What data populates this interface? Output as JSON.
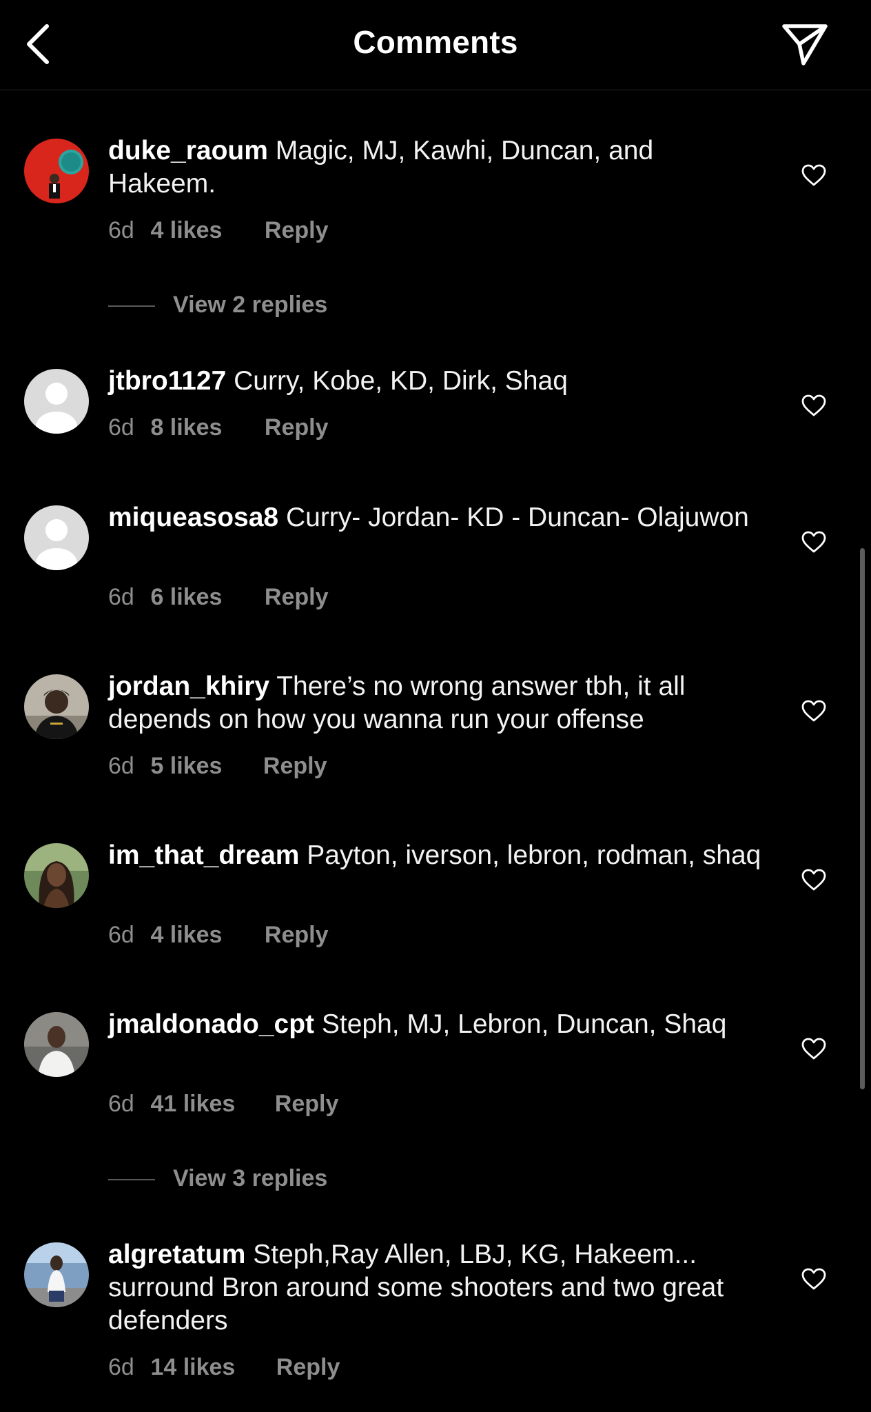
{
  "header": {
    "title": "Comments",
    "back_icon": "chevron-left-icon",
    "share_icon": "paper-plane-icon"
  },
  "colors": {
    "background": "#000000",
    "text": "#ffffff",
    "secondary_text": "#8e8e8e"
  },
  "comments": [
    {
      "username": "duke_raoum",
      "text": "Magic, MJ, Kawhi, Duncan, and Hakeem.",
      "age": "6d",
      "likes": "4 likes",
      "reply": "Reply",
      "view_replies": "View 2 replies"
    },
    {
      "username": "jtbro1127",
      "text": "Curry, Kobe, KD, Dirk, Shaq",
      "age": "6d",
      "likes": "8 likes",
      "reply": "Reply"
    },
    {
      "username": "miqueasosa8",
      "text": "Curry- Jordan- KD - Duncan- Olajuwon",
      "age": "6d",
      "likes": "6 likes",
      "reply": "Reply"
    },
    {
      "username": "jordan_khiry",
      "text": "There’s no wrong answer tbh, it all depends on how you wanna run your offense",
      "age": "6d",
      "likes": "5 likes",
      "reply": "Reply"
    },
    {
      "username": "im_that_dream",
      "text": "Payton, iverson, lebron, rodman, shaq",
      "age": "6d",
      "likes": "4 likes",
      "reply": "Reply"
    },
    {
      "username": "jmaldonado_cpt",
      "text": "Steph, MJ, Lebron, Duncan, Shaq",
      "age": "6d",
      "likes": "41 likes",
      "reply": "Reply",
      "view_replies": "View 3 replies"
    },
    {
      "username": "algretatum",
      "text": "Steph,Ray Allen, LBJ, KG, Hakeem... surround Bron around some shooters and two great defenders",
      "age": "6d",
      "likes": "14 likes",
      "reply": "Reply"
    }
  ]
}
